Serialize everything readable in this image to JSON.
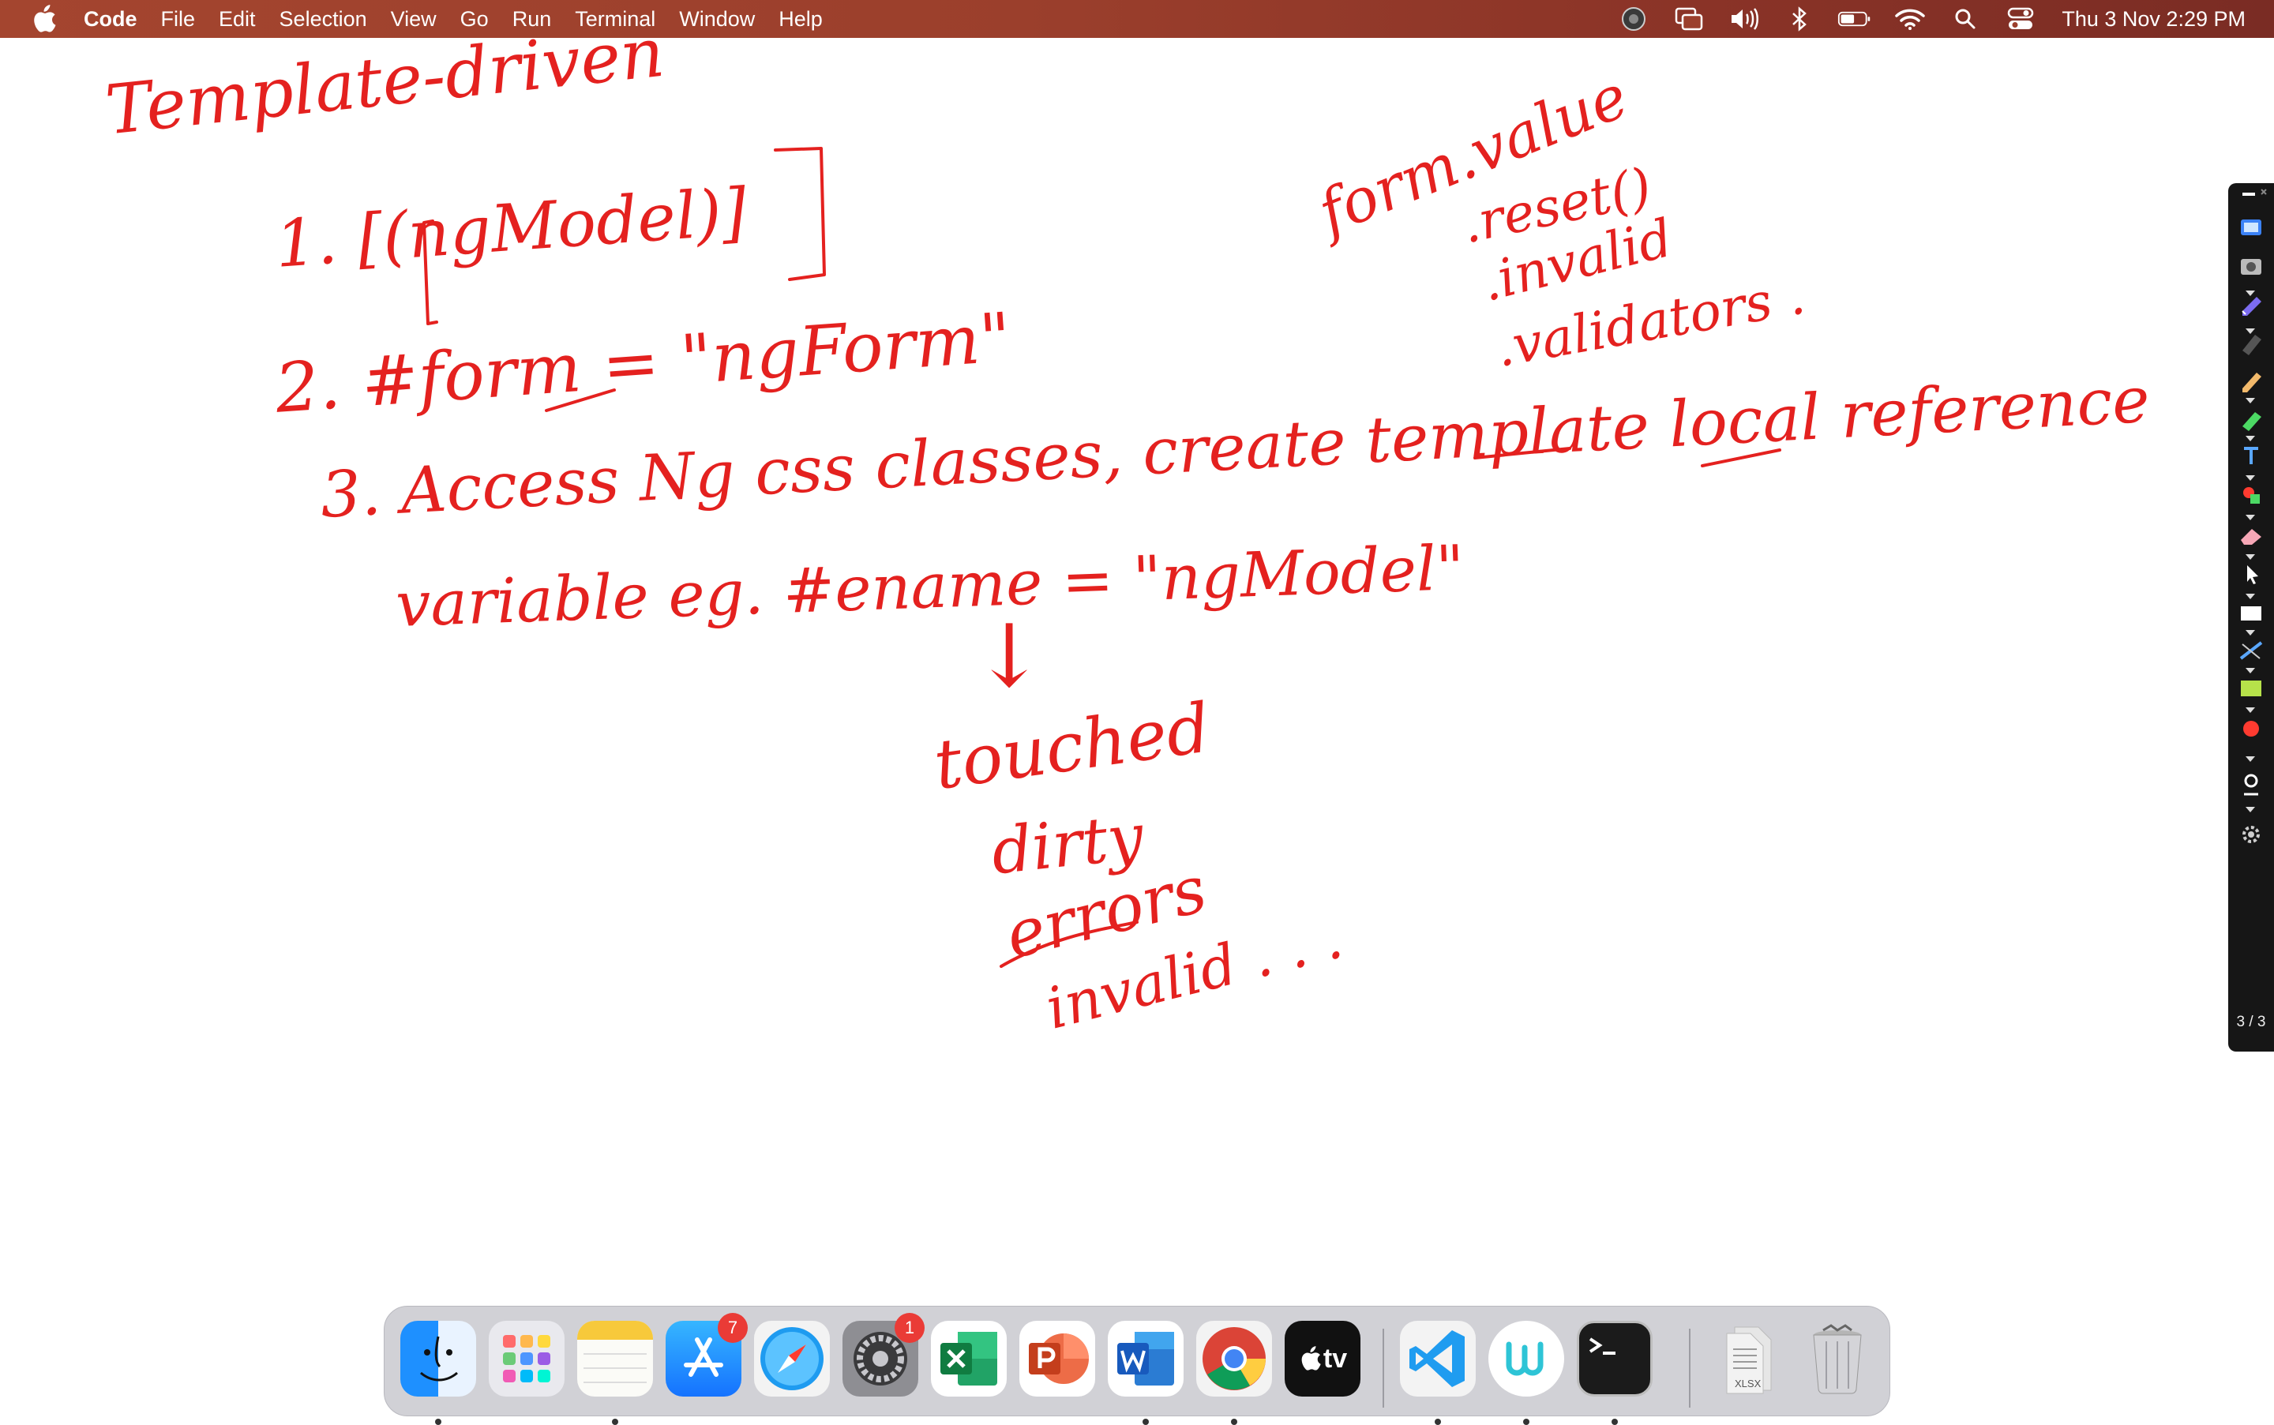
{
  "menubar": {
    "app_name": "Code",
    "items": [
      "File",
      "Edit",
      "Selection",
      "View",
      "Go",
      "Run",
      "Terminal",
      "Window",
      "Help"
    ],
    "status_icons": [
      "screen-recorder-icon",
      "screen-mirroring-icon",
      "volume-icon",
      "bluetooth-icon",
      "battery-icon",
      "wifi-icon",
      "spotlight-search-icon",
      "control-center-icon"
    ],
    "clock": "Thu 3 Nov  2:29 PM",
    "colors": {
      "bar_start": "#a4452f",
      "bar_end": "#7a2c24"
    }
  },
  "whiteboard": {
    "ink_color": "#e4211f",
    "lines": {
      "title": "Template-driven",
      "item1": "1. [(ngModel)]",
      "item2": "2. #form = \"ngForm\"",
      "item3": "3. Access Ng css classes, create template local reference",
      "item3_cont": "variable eg. #ename = \"ngModel\"",
      "form_props": [
        "form.value",
        ".reset()",
        ".invalid",
        ".validators ."
      ],
      "arrow": "↓",
      "control_props": [
        "touched",
        "dirty",
        "errors",
        "invalid . . ."
      ]
    }
  },
  "annotation_toolbar": {
    "tools": [
      "minimize",
      "select-screen",
      "screenshot",
      "pen",
      "marker",
      "pencil",
      "highlighter",
      "text",
      "shapes",
      "eraser",
      "pointer",
      "whiteboard",
      "line",
      "fill",
      "record",
      "spotlight",
      "settings"
    ],
    "page_counter": "3 / 3"
  },
  "dock": {
    "apps": [
      {
        "name": "Finder",
        "running": true
      },
      {
        "name": "Launchpad",
        "running": false
      },
      {
        "name": "Notes",
        "running": true
      },
      {
        "name": "App Store",
        "running": false,
        "badge": "7"
      },
      {
        "name": "Safari",
        "running": false
      },
      {
        "name": "System Preferences",
        "running": false,
        "badge": "1"
      },
      {
        "name": "Microsoft Excel",
        "running": false
      },
      {
        "name": "Microsoft PowerPoint",
        "running": false
      },
      {
        "name": "Microsoft Word",
        "running": true
      },
      {
        "name": "Google Chrome",
        "running": true
      },
      {
        "name": "Apple TV",
        "running": false,
        "label": "tv"
      },
      {
        "name": "Visual Studio Code",
        "running": true
      },
      {
        "name": "Whiteboard",
        "running": true
      },
      {
        "name": "Terminal",
        "running": true
      },
      {
        "name": "XLSX document",
        "running": false,
        "label": "XLSX"
      },
      {
        "name": "Trash",
        "running": false
      }
    ]
  }
}
